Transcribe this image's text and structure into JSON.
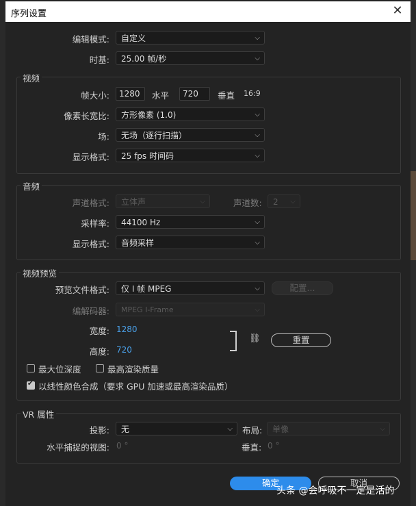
{
  "dialog": {
    "title": "序列设置",
    "close_glyph": "✕"
  },
  "general": {
    "edit_mode_label": "编辑模式:",
    "edit_mode_value": "自定义",
    "timebase_label": "时基:",
    "timebase_value": "25.00  帧/秒"
  },
  "video": {
    "group_title": "视频",
    "frame_size_label": "帧大小:",
    "width": "1280",
    "horizontal_label": "水平",
    "height": "720",
    "vertical_label": "垂直",
    "aspect": "16:9",
    "pixel_aspect_label": "像素长宽比:",
    "pixel_aspect_value": "方形像素 (1.0)",
    "fields_label": "场:",
    "fields_value": "无场（逐行扫描）",
    "display_format_label": "显示格式:",
    "display_format_value": "25 fps 时间码"
  },
  "audio": {
    "group_title": "音频",
    "channel_format_label": "声道格式:",
    "channel_format_value": "立体声",
    "channels_label": "声道数:",
    "channels_value": "2",
    "sample_rate_label": "采样率:",
    "sample_rate_value": "44100 Hz",
    "display_format_label": "显示格式:",
    "display_format_value": "音频采样"
  },
  "preview": {
    "group_title": "视频预览",
    "file_format_label": "预览文件格式:",
    "file_format_value": "仅 I 帧 MPEG",
    "configure_label": "配置...",
    "codec_label": "编解码器:",
    "codec_value": "MPEG I-Frame",
    "width_label": "宽度:",
    "width_value": "1280",
    "height_label": "高度:",
    "height_value": "720",
    "reset_label": "重置",
    "max_bit_depth_label": "最大位深度",
    "max_render_quality_label": "最高渲染质量",
    "linear_color_label": "以线性颜色合成（要求 GPU 加速或最高渲染品质）",
    "max_bit_depth_checked": false,
    "max_render_quality_checked": false,
    "linear_color_checked": true
  },
  "vr": {
    "group_title": "VR 属性",
    "projection_label": "投影:",
    "projection_value": "无",
    "layout_label": "布局:",
    "layout_value": "单像",
    "h_fov_label": "水平捕捉的视图:",
    "h_fov_value": "0 °",
    "v_label": "垂直:",
    "v_value": "0 °"
  },
  "footer": {
    "ok_label": "确定",
    "cancel_label": "取消"
  },
  "watermark": "头条 @会呼吸不一定是活的",
  "colors": {
    "accent": "#2d8ceb",
    "link": "#4aa0e8",
    "background": "#232323"
  }
}
